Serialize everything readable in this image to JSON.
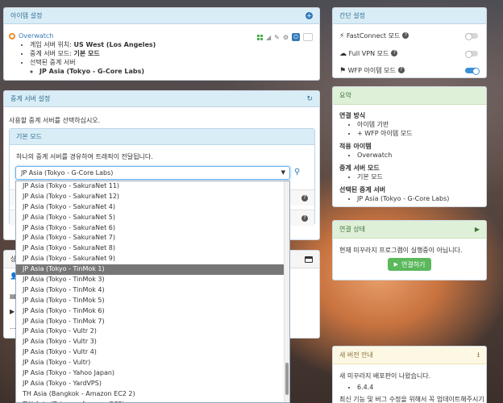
{
  "item_panel": {
    "title": "아이템 설정",
    "game_name": "Overwatch",
    "details": [
      {
        "label": "게임 서버 위치:",
        "value": "US West (Los Angeles)"
      },
      {
        "label": "중계 서버 모드:",
        "value": "기본 모드"
      },
      {
        "label": "선택된 중계 서버",
        "value": ""
      }
    ],
    "selected_server": "JP Asia (Tokyo - G-Core Labs)"
  },
  "quick_settings": {
    "title": "간단 설정",
    "items": [
      {
        "icon": "lightning-icon",
        "label": "FastConnect 모드",
        "on": false
      },
      {
        "icon": "cloud-icon",
        "label": "Full VPN 모드",
        "on": false
      },
      {
        "icon": "flag-icon",
        "label": "WFP 아이템 모드",
        "on": true
      }
    ]
  },
  "relay_panel": {
    "title": "중계 서버 설정",
    "description": "사용할 중계 서버를 선택하십시오.",
    "basic_mode_title": "기본 모드",
    "basic_mode_desc": "하나의 중계 서버를 경유하여 트래픽이 전달됩니다.",
    "selected": "JP Asia (Tokyo - G-Core Labs)",
    "options": [
      "JP Asia (Tokyo - SakuraNet 11)",
      "JP Asia (Tokyo - SakuraNet 12)",
      "JP Asia (Tokyo - SakuraNet 4)",
      "JP Asia (Tokyo - SakuraNet 5)",
      "JP Asia (Tokyo - SakuraNet 6)",
      "JP Asia (Tokyo - SakuraNet 7)",
      "JP Asia (Tokyo - SakuraNet 8)",
      "JP Asia (Tokyo - SakuraNet 9)",
      "JP Asia (Tokyo - TinMok 1)",
      "JP Asia (Tokyo - TinMok 3)",
      "JP Asia (Tokyo - TinMok 4)",
      "JP Asia (Tokyo - TinMok 5)",
      "JP Asia (Tokyo - TinMok 6)",
      "JP Asia (Tokyo - TinMok 7)",
      "JP Asia (Tokyo - Vultr 2)",
      "JP Asia (Tokyo - Vultr 3)",
      "JP Asia (Tokyo - Vultr 4)",
      "JP Asia (Tokyo - Vultr)",
      "JP Asia (Tokyo - Yahoo Japan)",
      "JP Asia (Tokyo - YardVPS)",
      "TH Asia (Bangkok - Amazon EC2 2)",
      "TW Asia (Taiwan - Amazon EC2)"
    ],
    "highlighted_option": "JP Asia (Tokyo - TinMok 1)"
  },
  "lower_panel": {
    "title_fragment": "상"
  },
  "summary": {
    "title": "요약",
    "sections": [
      {
        "heading": "연결 방식",
        "items": [
          "아이템 기반",
          "+ WFP 아이템 모드"
        ]
      },
      {
        "heading": "적용 아이템",
        "items": [
          "Overwatch"
        ]
      },
      {
        "heading": "중계 서버 모드",
        "items": [
          "기본 모드"
        ]
      },
      {
        "heading": "선택된 중계 서버",
        "items": [
          "JP Asia (Tokyo - G-Core Labs)"
        ]
      }
    ]
  },
  "connection": {
    "title": "연결 상태",
    "status_text": "현재 미꾸라지 프로그램이 실행중이 아닙니다.",
    "connect_label": "연결하기"
  },
  "new_version": {
    "title": "새 버전 안내",
    "message": "새 미꾸라지 배포판이 나왔습니다.",
    "version": "6.4.4",
    "more": "최신 기능 및 버그 수정을 위해서 꼭 업데이트해주시기 바"
  },
  "colors": {
    "panel_head_blue": "#d9edf7",
    "panel_head_green": "#dff0d8",
    "panel_head_yellow": "#fcf8e3",
    "button_green": "#5cb85c",
    "toggle_on": "#3d8fd6"
  }
}
